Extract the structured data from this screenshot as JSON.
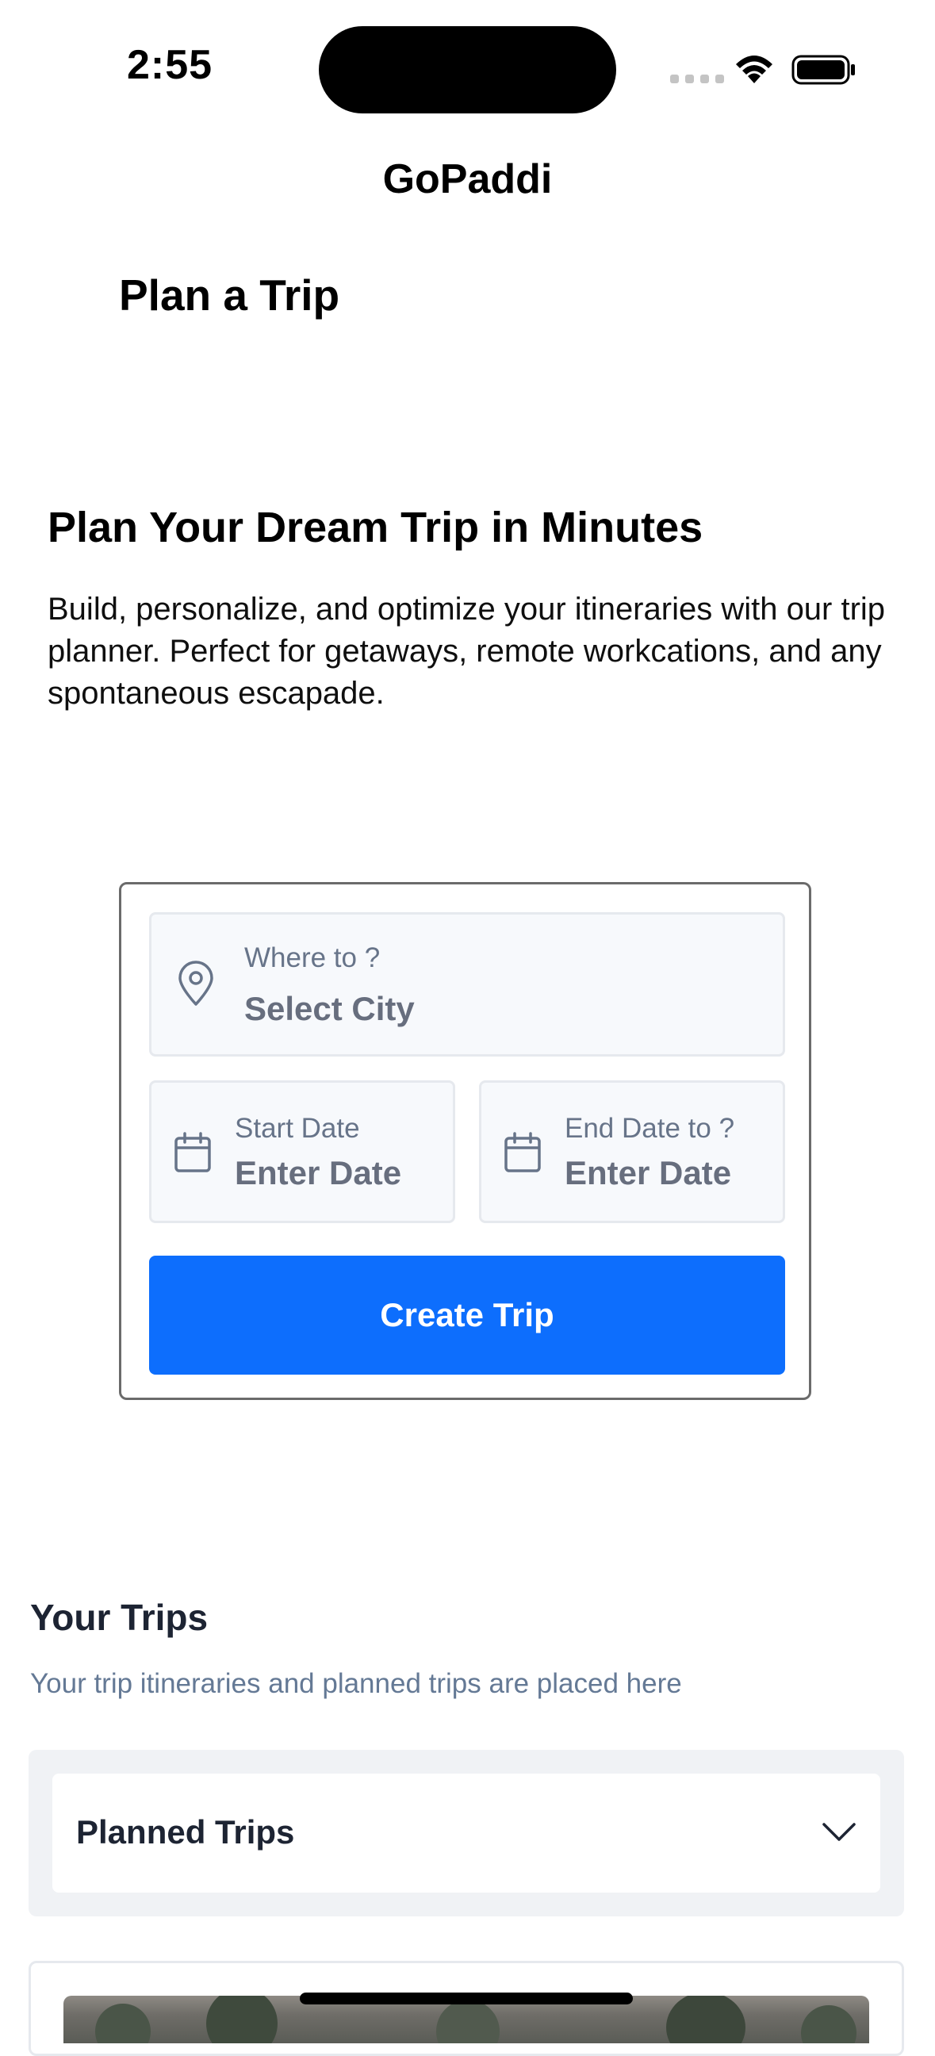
{
  "status_bar": {
    "time": "2:55"
  },
  "header": {
    "app_title": "GoPaddi",
    "page_title": "Plan a Trip"
  },
  "hero": {
    "title": "Plan Your Dream Trip in Minutes",
    "description": "Build, personalize, and optimize your itineraries with our trip planner. Perfect for getaways, remote workcations, and any spontaneous escapade."
  },
  "plan_form": {
    "destination": {
      "label": "Where to ?",
      "value": "Select City"
    },
    "start_date": {
      "label": "Start Date",
      "value": "Enter Date"
    },
    "end_date": {
      "label": "End Date to ?",
      "value": "Enter Date"
    },
    "create_label": "Create Trip"
  },
  "trips": {
    "title": "Your Trips",
    "subtitle": "Your trip itineraries and  planned trips are placed here",
    "filter_selected": "Planned Trips"
  },
  "colors": {
    "primary": "#0d6efd",
    "field_bg": "#f7f9fc",
    "muted_text": "#677489"
  }
}
